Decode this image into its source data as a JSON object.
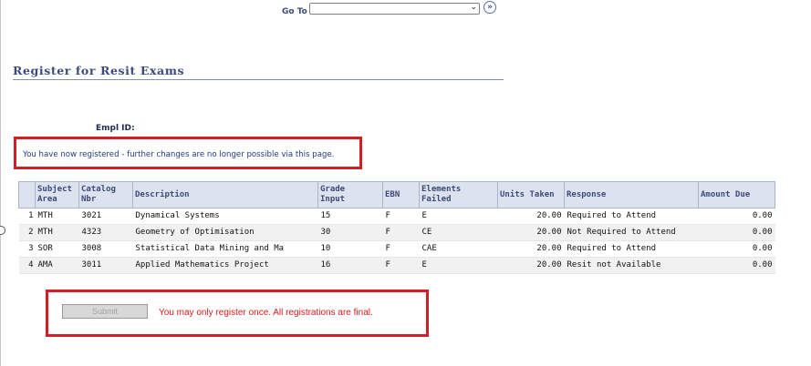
{
  "header": {
    "goto_label": "Go To",
    "goto_value": "",
    "goto_button_glyph": "»"
  },
  "page": {
    "title": "Register for Resit Exams",
    "empl_id_label": "Empl ID:",
    "empl_id_value": ""
  },
  "notice": {
    "text": "You have now registered - further changes are no longer possible via this page."
  },
  "grid": {
    "columns": [
      {
        "line1": "",
        "line2": ""
      },
      {
        "line1": "Subject",
        "line2": "Area"
      },
      {
        "line1": "Catalog",
        "line2": "Nbr"
      },
      {
        "line1": "Description",
        "line2": ""
      },
      {
        "line1": "Grade",
        "line2": "Input"
      },
      {
        "line1": "EBN",
        "line2": ""
      },
      {
        "line1": "Elements",
        "line2": "Failed"
      },
      {
        "line1": "Units Taken",
        "line2": ""
      },
      {
        "line1": "Response",
        "line2": ""
      },
      {
        "line1": "Amount Due",
        "line2": ""
      }
    ],
    "rows": [
      {
        "num": "1",
        "subject": "MTH",
        "catalog": "3021",
        "description": "Dynamical Systems",
        "grade": "15",
        "ebn": "F",
        "elements": "E",
        "units": "20.00",
        "response": "Required to Attend",
        "amount": "0.00"
      },
      {
        "num": "2",
        "subject": "MTH",
        "catalog": "4323",
        "description": "Geometry of Optimisation",
        "grade": "30",
        "ebn": "F",
        "elements": "CE",
        "units": "20.00",
        "response": "Not Required to Attend",
        "amount": "0.00"
      },
      {
        "num": "3",
        "subject": "SOR",
        "catalog": "3008",
        "description": "Statistical Data Mining and Ma",
        "grade": "10",
        "ebn": "F",
        "elements": "CAE",
        "units": "20.00",
        "response": "Required to Attend",
        "amount": "0.00"
      },
      {
        "num": "4",
        "subject": "AMA",
        "catalog": "3011",
        "description": "Applied Mathematics Project",
        "grade": "16",
        "ebn": "F",
        "elements": "E",
        "units": "20.00",
        "response": "Resit not Available",
        "amount": "0.00"
      }
    ]
  },
  "footer": {
    "submit_label": "Submit",
    "message": "You may only register once. All registrations are final."
  },
  "colors": {
    "highlight_border": "#d11f25",
    "header_text": "#3b4a7a",
    "grid_header_bg": "#dde3ee",
    "error_text": "#e01818"
  }
}
